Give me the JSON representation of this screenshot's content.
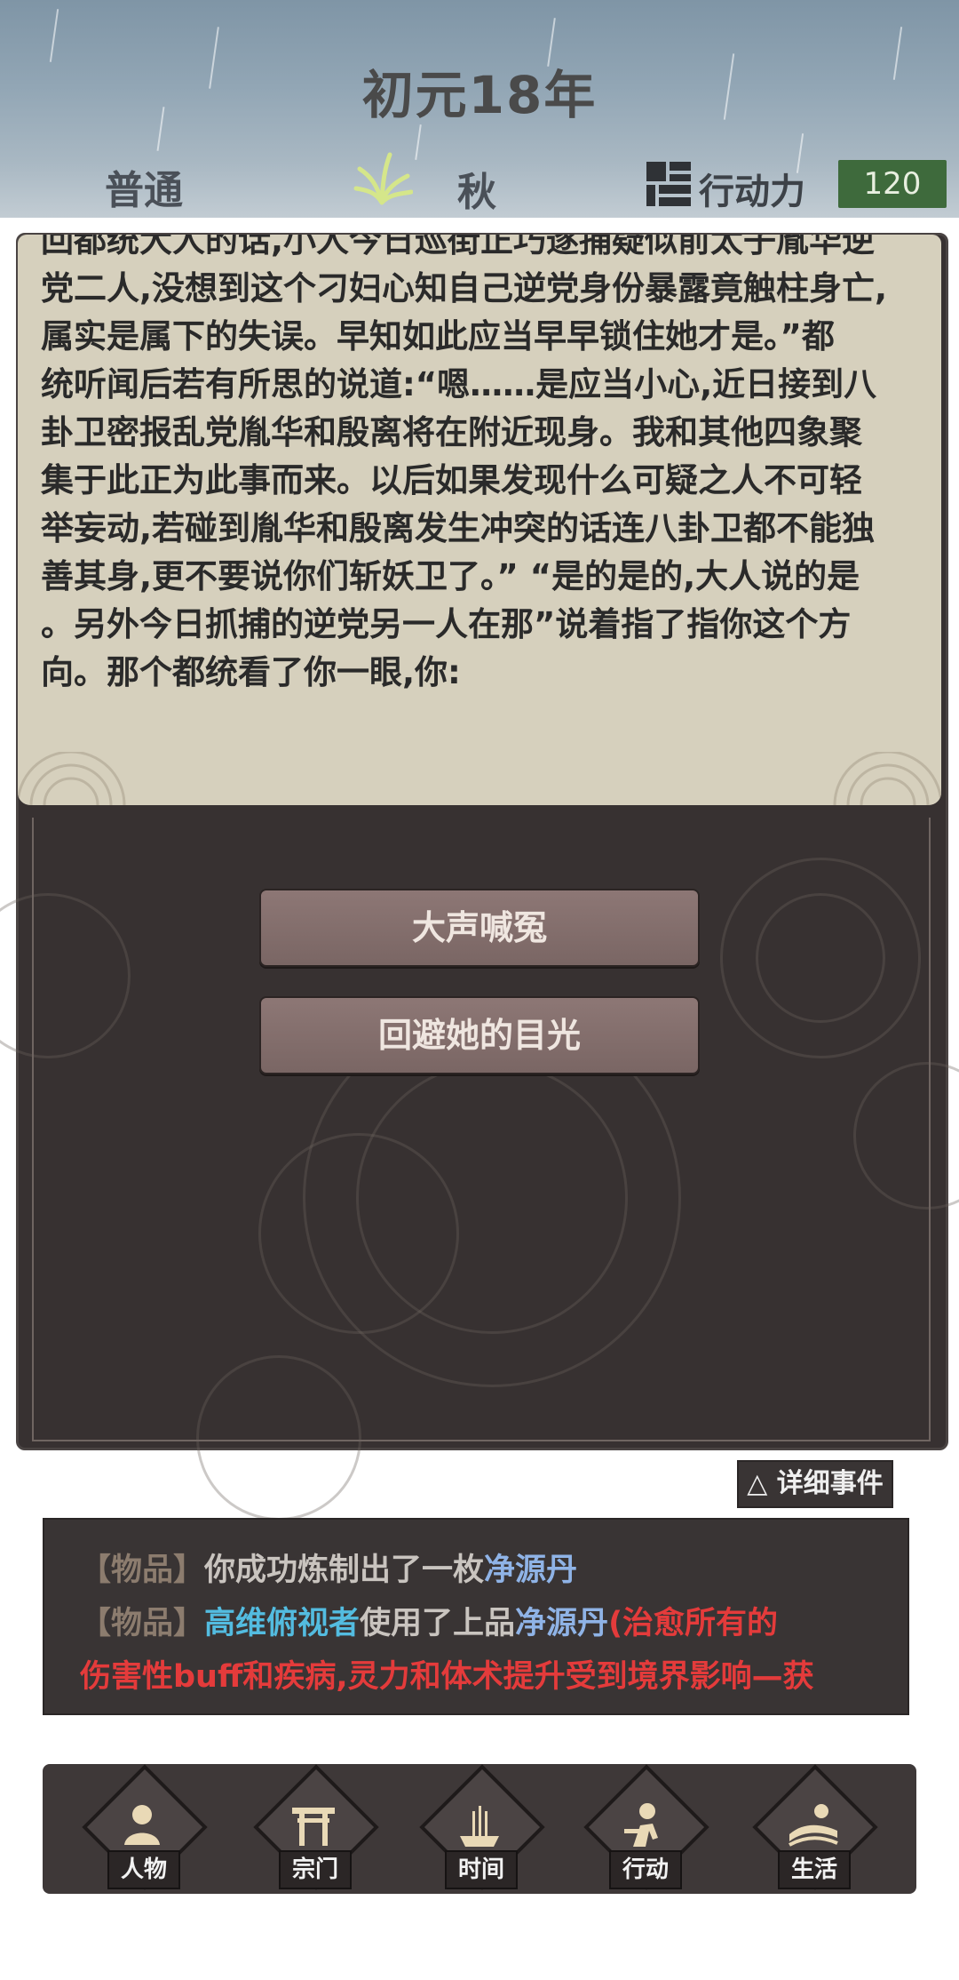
{
  "header": {
    "year": "初元18年",
    "difficulty": "普通",
    "season": "秋",
    "action_label": "行动力",
    "action_value": "120"
  },
  "story": {
    "lines": [
      "回都统大人的话,小人今日巡街正巧遂捕疑似前太子胤华逆",
      "党二人,没想到这个刁妇心知自己逆党身份暴露竟触柱身亡,",
      "属实是属下的失误。早知如此应当早早锁住她才是。”都",
      "统听闻后若有所思的说道:“嗯……是应当小心,近日接到八",
      "卦卫密报乱党胤华和殷离将在附近现身。我和其他四象聚",
      "集于此正为此事而来。以后如果发现什么可疑之人不可轻",
      "举妄动,若碰到胤华和殷离发生冲突的话连八卦卫都不能独",
      "善其身,更不要说你们斩妖卫了。” “是的是的,大人说的是",
      "。另外今日抓捕的逆党另一人在那”说着指了指你这个方",
      "向。那个都统看了你一眼,你:"
    ]
  },
  "choices": [
    "大声喊冤",
    "回避她的目光"
  ],
  "detail_button": "△ 详细事件",
  "log": {
    "line1": {
      "tag": "【物品】",
      "text": "你成功炼制出了一枚",
      "item": "净源丹"
    },
    "line2": {
      "tag": "【物品】",
      "name": "高维俯视者",
      "text": "使用了上品",
      "item": "净源丹",
      "effect": "(治愈所有的"
    },
    "line3": "伤害性buff和疾病,灵力和体术提升受到境界影响—获"
  },
  "nav": [
    {
      "label": "人物",
      "icon": "person-icon"
    },
    {
      "label": "宗门",
      "icon": "gate-icon"
    },
    {
      "label": "时间",
      "icon": "incense-icon"
    },
    {
      "label": "行动",
      "icon": "action-icon"
    },
    {
      "label": "生活",
      "icon": "life-icon"
    }
  ]
}
